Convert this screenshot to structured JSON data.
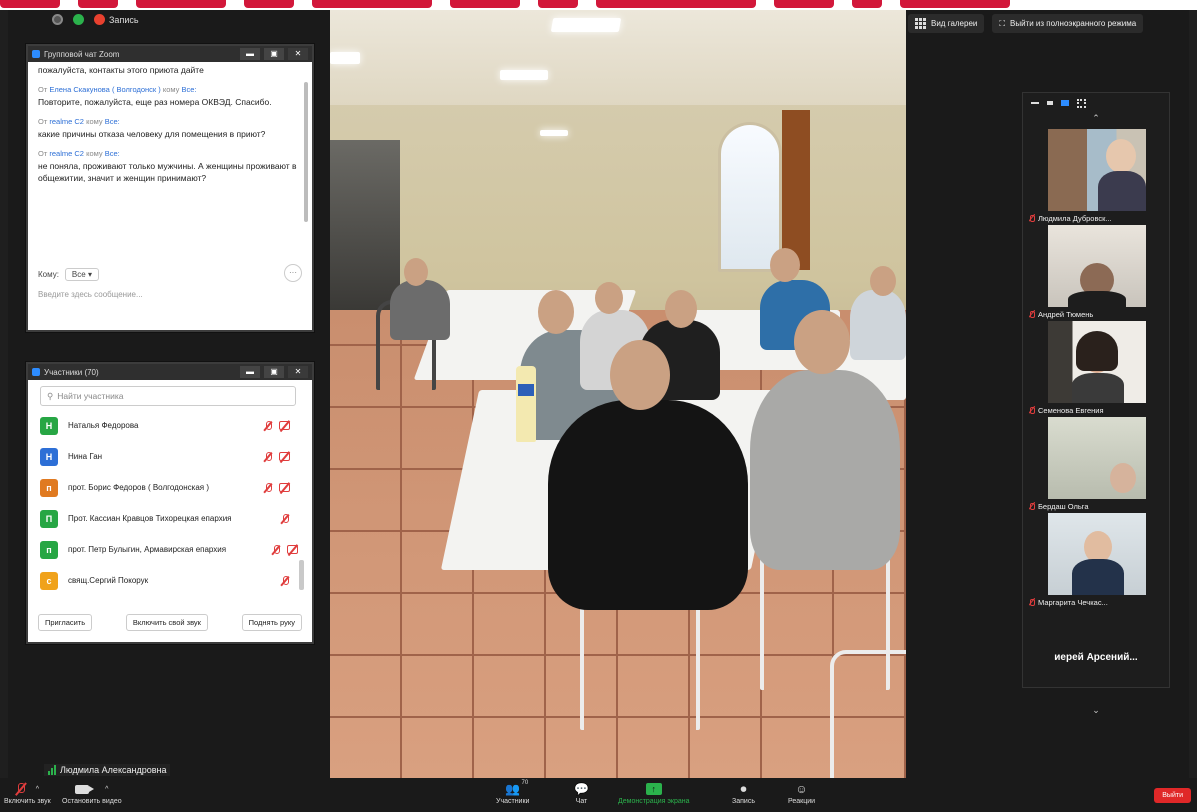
{
  "status": {
    "recording_label": "Запись"
  },
  "top_buttons": {
    "gallery_view": "Вид галереи",
    "exit_fullscreen": "Выйти из полноэкранного режима"
  },
  "chat": {
    "title": "Групповой чат Zoom",
    "messages": [
      {
        "from": "",
        "to": "",
        "text": "пожалуйста, контакты этого приюта дайте"
      },
      {
        "from_prefix": "От",
        "from": "Елена Скакунова ( Волгодонск )",
        "to_prefix": "кому",
        "to": "Все:",
        "text": "Повторите, пожалуйста, еще раз номера ОКВЭД. Спасибо."
      },
      {
        "from_prefix": "От",
        "from": "realme C2",
        "to_prefix": "кому",
        "to": "Все:",
        "text": "какие причины  отказа человеку для помещения в приют?"
      },
      {
        "from_prefix": "От",
        "from": "realme C2",
        "to_prefix": "кому",
        "to": "Все:",
        "text": "не поняла, проживают  только мужчины. А женщины проживают в общежитии, значит и женщин принимают?"
      }
    ],
    "to_label": "Кому:",
    "to_value": "Все",
    "input_placeholder": "Введите здесь сообщение..."
  },
  "participants": {
    "title": "Участники (70)",
    "search_placeholder": "Найти участника",
    "list": [
      {
        "initial": "Н",
        "color": "#27a644",
        "name": "Наталья Федорова",
        "mic_off": true,
        "cam_off": true
      },
      {
        "initial": "Н",
        "color": "#2d6fd6",
        "name": "Нина Ган",
        "mic_off": true,
        "cam_off": true
      },
      {
        "initial": "п",
        "color": "#e07a21",
        "name": "прот. Борис Федоров ( Волгодонская )",
        "mic_off": true,
        "cam_off": true
      },
      {
        "initial": "П",
        "color": "#27a644",
        "name": "Прот. Кассиан Кравцов Тихорецкая епархия",
        "mic_off": true,
        "cam_off": false
      },
      {
        "initial": "п",
        "color": "#27a644",
        "name": "прот. Петр Булыгин, Армавирская епархия",
        "mic_off": true,
        "cam_off": true
      },
      {
        "initial": "с",
        "color": "#f0a21b",
        "name": "свящ.Сергий Покорук",
        "mic_off": true,
        "cam_off": false
      }
    ],
    "buttons": {
      "invite": "Пригласить",
      "unmute_me": "Включить свой звук",
      "raise_hand": "Поднять руку"
    }
  },
  "gallery": {
    "tiles": [
      {
        "name": "Людмила Дубровск..."
      },
      {
        "name": "Андрей Тюмень"
      },
      {
        "name": "Семенова Евгения"
      },
      {
        "name": "Бердаш Ольга"
      },
      {
        "name": "Маргарита Чечкас..."
      }
    ],
    "name_only_tile": "иерей  Арсений..."
  },
  "self_name": "Людмила Александровна",
  "toolbar": {
    "unmute": "Включить звук",
    "stop_video": "Остановить видео",
    "participants": "Участники",
    "participants_count": "70",
    "chat": "Чат",
    "share_screen": "Демонстрация экрана",
    "record": "Запись",
    "reactions": "Реакции",
    "leave": "Выйти"
  }
}
